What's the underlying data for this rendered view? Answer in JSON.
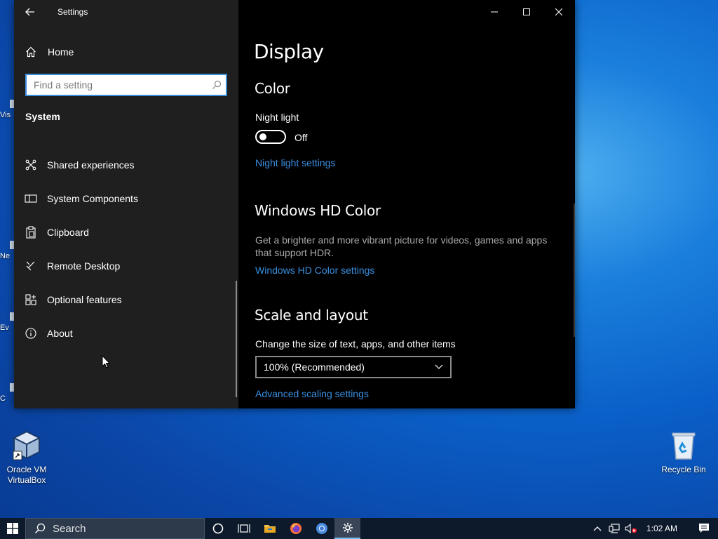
{
  "desktop": {
    "icons": [
      {
        "label_line1": "Oracle VM",
        "label_line2": "VirtualBox"
      },
      {
        "label_line1": "Recycle Bin",
        "label_line2": ""
      }
    ],
    "partial_labels": [
      "Vis",
      "Ne",
      "Ev",
      "C"
    ]
  },
  "window": {
    "title": "Settings",
    "sidebar": {
      "home_label": "Home",
      "search_placeholder": "Find a setting",
      "section": "System",
      "items": [
        {
          "label": "Shared experiences",
          "icon": "shared-experiences-icon"
        },
        {
          "label": "System Components",
          "icon": "system-components-icon"
        },
        {
          "label": "Clipboard",
          "icon": "clipboard-icon"
        },
        {
          "label": "Remote Desktop",
          "icon": "remote-desktop-icon"
        },
        {
          "label": "Optional features",
          "icon": "optional-features-icon"
        },
        {
          "label": "About",
          "icon": "info-icon"
        }
      ]
    },
    "main": {
      "page_title": "Display",
      "color_section": {
        "heading": "Color",
        "night_light_label": "Night light",
        "toggle_state": "Off",
        "night_light_link": "Night light settings"
      },
      "hd_section": {
        "heading": "Windows HD Color",
        "description": "Get a brighter and more vibrant picture for videos, games and apps that support HDR.",
        "link": "Windows HD Color settings"
      },
      "scale_section": {
        "heading": "Scale and layout",
        "label": "Change the size of text, apps, and other items",
        "dropdown_value": "100% (Recommended)",
        "link": "Advanced scaling settings"
      }
    }
  },
  "taskbar": {
    "search_placeholder": "Search",
    "clock": "1:02 AM",
    "accent_color": "#76b9ed"
  }
}
